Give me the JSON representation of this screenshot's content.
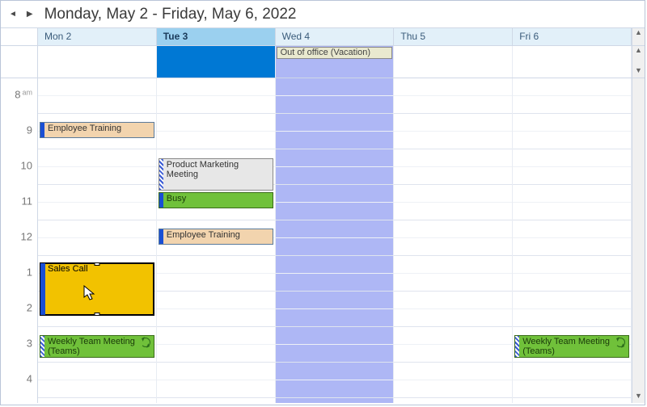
{
  "header": {
    "title": "Monday, May 2 - Friday, May 6, 2022"
  },
  "days": [
    {
      "label": "Mon 2",
      "selected": false,
      "vacation": false
    },
    {
      "label": "Tue 3",
      "selected": true,
      "vacation": false
    },
    {
      "label": "Wed 4",
      "selected": false,
      "vacation": true
    },
    {
      "label": "Thu 5",
      "selected": false,
      "vacation": false
    },
    {
      "label": "Fri 6",
      "selected": false,
      "vacation": false
    }
  ],
  "allday": {
    "wed": {
      "label": "Out of office (Vacation)"
    }
  },
  "hours": [
    {
      "n": "8",
      "ampm": "am"
    },
    {
      "n": "9",
      "ampm": ""
    },
    {
      "n": "10",
      "ampm": ""
    },
    {
      "n": "11",
      "ampm": ""
    },
    {
      "n": "12",
      "ampm": ""
    },
    {
      "n": "1",
      "ampm": ""
    },
    {
      "n": "2",
      "ampm": ""
    },
    {
      "n": "3",
      "ampm": ""
    },
    {
      "n": "4",
      "ampm": ""
    }
  ],
  "appts": {
    "mon_training": "Employee Training",
    "mon_sales": "Sales Call",
    "mon_weekly": "Weekly Team Meeting (Teams)",
    "tue_marketing": "Product Marketing Meeting",
    "tue_busy": "Busy",
    "tue_training": "Employee Training",
    "fri_weekly": "Weekly Team Meeting (Teams)"
  }
}
